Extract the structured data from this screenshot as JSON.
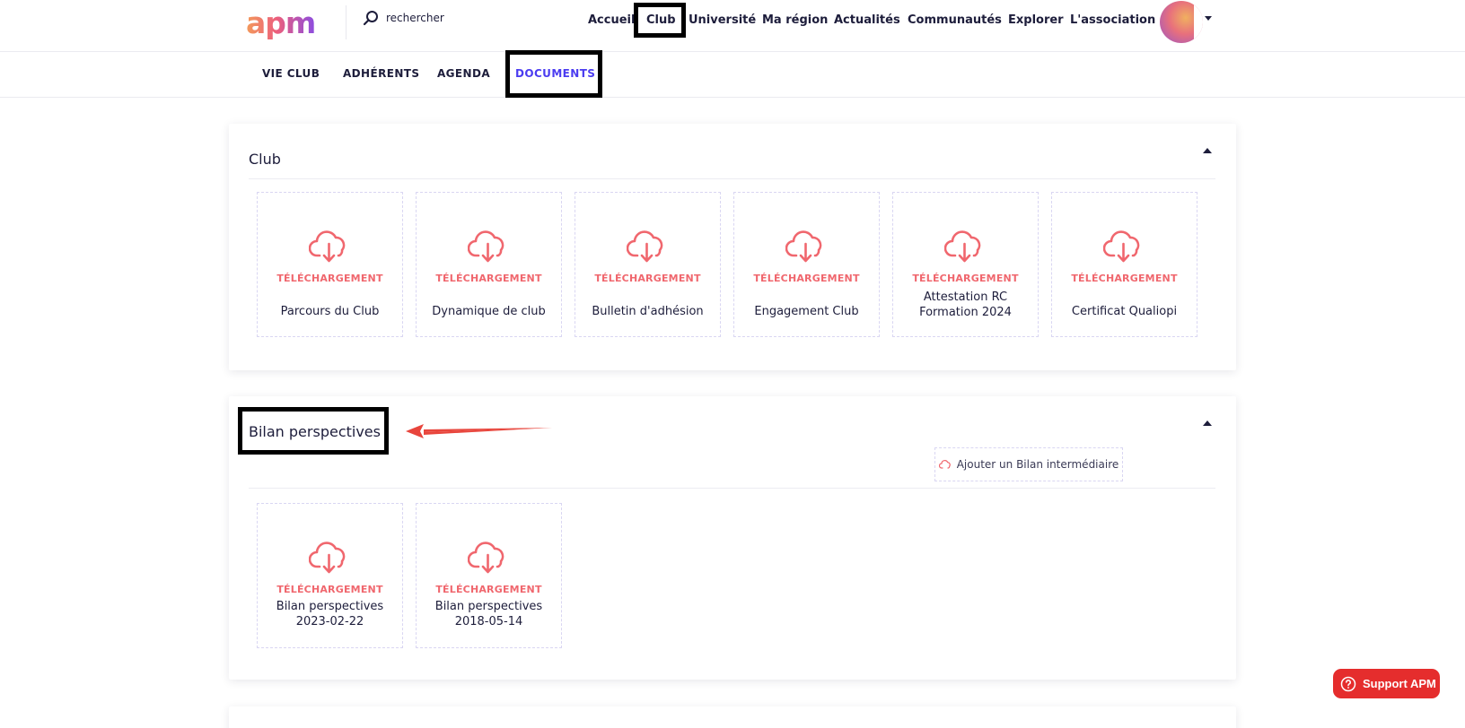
{
  "header": {
    "logo_text": "apm",
    "search": {
      "placeholder": "rechercher"
    },
    "nav": [
      "Accueil",
      "Club",
      "Université",
      "Ma région",
      "Actualités",
      "Communautés",
      "Explorer",
      "L'association"
    ],
    "active_nav": "Club"
  },
  "subnav": {
    "tabs": [
      "VIE CLUB",
      "ADHÉRENTS",
      "AGENDA",
      "DOCUMENTS"
    ],
    "active": "DOCUMENTS"
  },
  "sections": [
    {
      "title": "Club",
      "documents": [
        {
          "action": "TÉLÉCHARGEMENT",
          "name": "Parcours du Club"
        },
        {
          "action": "TÉLÉCHARGEMENT",
          "name": "Dynamique de club"
        },
        {
          "action": "TÉLÉCHARGEMENT",
          "name": "Bulletin d'adhésion"
        },
        {
          "action": "TÉLÉCHARGEMENT",
          "name": "Engagement Club"
        },
        {
          "action": "TÉLÉCHARGEMENT",
          "name": "Attestation RC Formation 2024"
        },
        {
          "action": "TÉLÉCHARGEMENT",
          "name": "Certificat Qualiopi"
        }
      ]
    },
    {
      "title": "Bilan perspectives",
      "add_button": "Ajouter un Bilan intermédiaire",
      "documents": [
        {
          "action": "TÉLÉCHARGEMENT",
          "name": "Bilan perspectives 2023-02-22"
        },
        {
          "action": "TÉLÉCHARGEMENT",
          "name": "Bilan perspectives 2018-05-14"
        }
      ]
    }
  ],
  "support_button": "Support APM",
  "colors": {
    "accent": "#4b3cf0",
    "download": "#f0676e",
    "support": "#e52d2d",
    "arrow": "#e8453c"
  },
  "icons": [
    "search-icon",
    "cloud-download-icon",
    "chevron-up-icon",
    "caret-down-icon",
    "help-circle-icon"
  ]
}
